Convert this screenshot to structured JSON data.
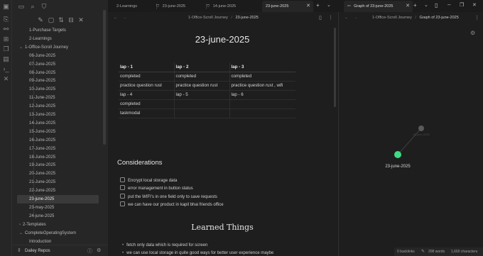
{
  "ribbon": {
    "icons": [
      "files-icon",
      "graph-icon",
      "canvas-icon",
      "pages-icon",
      "command-icon",
      "tools-icon"
    ]
  },
  "sidebar": {
    "toolbar_icons": [
      "sidebar-toggle-icon",
      "folder-icon",
      "search-icon",
      "bookmark-icon",
      "new-note-icon",
      "new-folder-icon",
      "sort-icon",
      "collapse-icon",
      "close-icon"
    ],
    "tree": [
      {
        "label": "1-Purchase Targets",
        "depth": 1,
        "active": false
      },
      {
        "label": "2-Learnings",
        "depth": 1,
        "active": false
      },
      {
        "label": "1-Office-Scroll Journey",
        "depth": 0,
        "active": false,
        "folder": "open"
      },
      {
        "label": "06-June-2025",
        "depth": 1,
        "active": false
      },
      {
        "label": "07-June-2025",
        "depth": 1,
        "active": false
      },
      {
        "label": "08-June-2025",
        "depth": 1,
        "active": false
      },
      {
        "label": "09-June-2025",
        "depth": 1,
        "active": false
      },
      {
        "label": "10-June-2025",
        "depth": 1,
        "active": false
      },
      {
        "label": "11-June-2025",
        "depth": 1,
        "active": false
      },
      {
        "label": "12-June-2025",
        "depth": 1,
        "active": false
      },
      {
        "label": "13-June-2025",
        "depth": 1,
        "active": false
      },
      {
        "label": "14-June-2025",
        "depth": 1,
        "active": false
      },
      {
        "label": "15-June-2025",
        "depth": 1,
        "active": false
      },
      {
        "label": "16-June-2025",
        "depth": 1,
        "active": false
      },
      {
        "label": "17-June-2025",
        "depth": 1,
        "active": false
      },
      {
        "label": "18-June-2025",
        "depth": 1,
        "active": false
      },
      {
        "label": "19-June-2025",
        "depth": 1,
        "active": false
      },
      {
        "label": "20-June-2025",
        "depth": 1,
        "active": false
      },
      {
        "label": "21-June-2025",
        "depth": 1,
        "active": false
      },
      {
        "label": "22-June-2025",
        "depth": 1,
        "active": false
      },
      {
        "label": "23-june-2025",
        "depth": 1,
        "active": true
      },
      {
        "label": "23-may-2025",
        "depth": 1,
        "active": false
      },
      {
        "label": "24-june-2025",
        "depth": 1,
        "active": false
      },
      {
        "label": "2-Templates",
        "depth": 0,
        "active": false,
        "folder": "closed"
      },
      {
        "label": "CompleteOperatingSystem",
        "depth": 0,
        "active": false,
        "folder": "open"
      },
      {
        "label": "Introduction",
        "depth": 1,
        "active": false
      }
    ],
    "vault_name": "Dailey Repos"
  },
  "tabs": [
    {
      "label": "2-Learnings",
      "icon": "",
      "active": false
    },
    {
      "label": "23-june-2025",
      "icon": "bookmark-icon",
      "active": false
    },
    {
      "label": "14-june-2025",
      "icon": "bookmark-icon",
      "active": false
    },
    {
      "label": "23-june-2025",
      "icon": "",
      "active": true
    },
    {
      "label": "Graph of 23-june-2025",
      "icon": "graph-icon",
      "active": true
    }
  ],
  "editor": {
    "breadcrumb_folder": "1-Office-Scroll Journey",
    "breadcrumb_sep": "/",
    "breadcrumb_file": "23-june-2025",
    "title": "23-june-2025",
    "table": {
      "headers": [
        "lap - 1",
        "lap - 2",
        "lap - 3"
      ],
      "rows": [
        [
          "completed",
          "completed",
          "completed"
        ],
        [
          "practice question rust",
          "practice question rust",
          "practice question rust , wifi"
        ],
        [
          "lap - 4",
          "lap - 5",
          "lap - 6"
        ],
        [
          "completed",
          "",
          ""
        ],
        [
          "taskmodal",
          "",
          ""
        ]
      ]
    },
    "considerations_heading": "Considerations",
    "tasks": [
      "Encrypt local storage data",
      "error management in button status",
      "put the WIFI's in one field only to save requests",
      "we can have our product in kapil bhai friends office"
    ],
    "learned_heading": "Learned Things",
    "bullets": [
      "fetch only data which is required for screen",
      "we can use local storage in quite good ways for better user experience maybe"
    ]
  },
  "graph": {
    "breadcrumb_folder": "1-Office-Scroll Journey",
    "breadcrumb_sep": "/",
    "breadcrumb_file": "Graph of 23-june-2025",
    "node_label": "23-june-2025",
    "faded_node_label": "14-june-2025",
    "node_color": "#3ddc84"
  },
  "status": {
    "backlinks": "0 backlinks",
    "words": "208 words",
    "characters": "1,660 characters"
  }
}
